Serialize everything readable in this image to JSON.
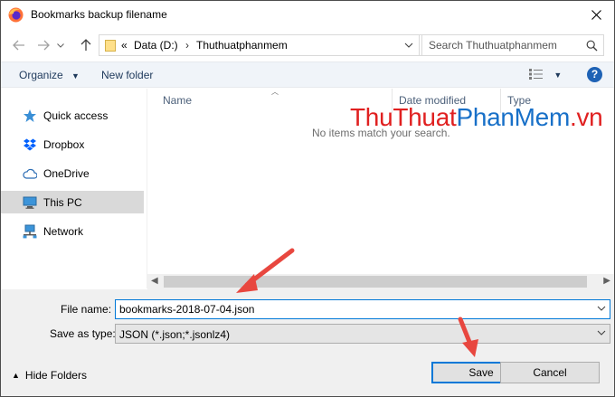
{
  "window": {
    "title": "Bookmarks backup filename"
  },
  "address_bar": {
    "overflow": "«",
    "crumbs": [
      "Data (D:)",
      "Thuthuatphanmem"
    ]
  },
  "search": {
    "placeholder": "Search Thuthuatphanmem"
  },
  "toolbar": {
    "organize_label": "Organize",
    "new_folder_label": "New folder",
    "help_label": "?"
  },
  "nav_pane": {
    "items": [
      {
        "label": "Quick access",
        "icon": "star-icon"
      },
      {
        "label": "Dropbox",
        "icon": "dropbox-icon"
      },
      {
        "label": "OneDrive",
        "icon": "cloud-icon"
      },
      {
        "label": "This PC",
        "icon": "computer-icon",
        "selected": true
      },
      {
        "label": "Network",
        "icon": "network-icon"
      }
    ]
  },
  "file_list": {
    "columns": [
      "Name",
      "Date modified",
      "Type"
    ],
    "empty_message": "No items match your search."
  },
  "watermark": {
    "part1": "ThuThuat",
    "part2": "PhanMem",
    "part3": ".vn"
  },
  "form": {
    "file_name_label": "File name:",
    "file_name_value": "bookmarks-2018-07-04.json",
    "save_as_type_label": "Save as type:",
    "save_as_type_value": "JSON (*.json;*.jsonlz4)"
  },
  "footer": {
    "hide_folders_label": "Hide Folders",
    "save_label": "Save",
    "cancel_label": "Cancel"
  },
  "colors": {
    "accent": "#0078d7",
    "annotation_arrow": "#e8473f",
    "watermark_red": "#e02020",
    "watermark_blue": "#1870c8"
  }
}
